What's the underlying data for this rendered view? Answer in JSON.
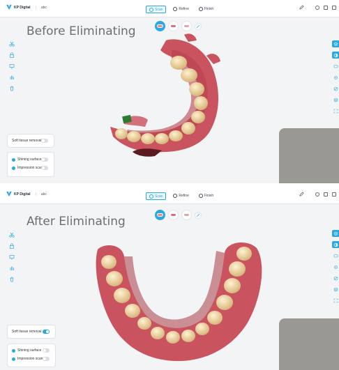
{
  "app": {
    "name": "KP Digital",
    "project": "abc"
  },
  "tabs": [
    {
      "label": "Scan",
      "active": true
    },
    {
      "label": "Refine",
      "active": false
    },
    {
      "label": "Finish",
      "active": false
    }
  ],
  "panels": {
    "top": {
      "title": "Before Eliminating",
      "soft_tissue_on": false
    },
    "bottom": {
      "title": "After Eliminating",
      "soft_tissue_on": true
    }
  },
  "options": {
    "soft_tissue_removal": "Soft tissue removal",
    "shining_surface": "Shining surface",
    "impression_scan": "Impression scan"
  },
  "colors": {
    "accent": "#2aa8e0",
    "gum": "#c9545f",
    "tooth": "#f0d79a"
  },
  "icons": {
    "left_toolbar": [
      "scissors-icon",
      "lock-icon",
      "screen-icon",
      "hand-icon",
      "trash-icon"
    ],
    "right_toolbar": [
      "layers-icon",
      "contrast-icon",
      "chat-icon",
      "settings-icon",
      "no-entry-icon",
      "target-icon",
      "fullscreen-icon"
    ]
  }
}
